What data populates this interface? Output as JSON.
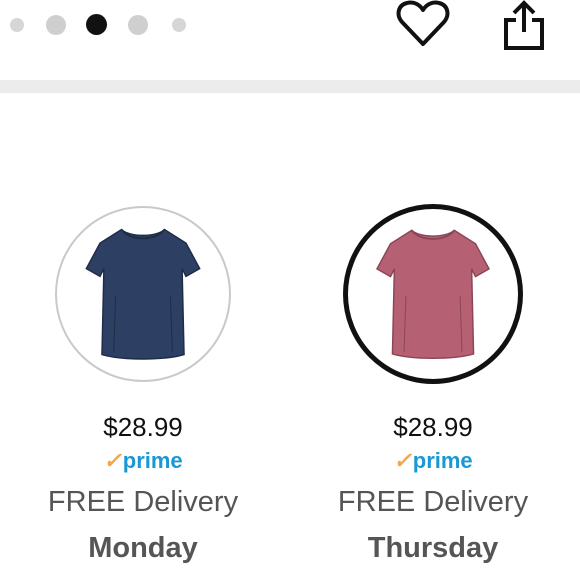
{
  "carousel": {
    "dot_count": 5,
    "active_index": 2
  },
  "actions": {
    "favorite_icon": "heart-outline-icon",
    "share_icon": "share-icon"
  },
  "variants": [
    {
      "color_hex": "#2d3f63",
      "price": "$28.99",
      "prime_check": "✓",
      "prime_label": "prime",
      "delivery": "FREE Delivery",
      "day": "Monday",
      "selected": false
    },
    {
      "color_hex": "#b56173",
      "price": "$28.99",
      "prime_check": "✓",
      "prime_label": "prime",
      "delivery": "FREE Delivery",
      "day": "Thursday",
      "selected": true
    }
  ],
  "colors": {
    "prime_check": "#f3a847",
    "prime_text": "#1a98d5",
    "selected_ring": "#111111",
    "divider": "#ececec"
  }
}
